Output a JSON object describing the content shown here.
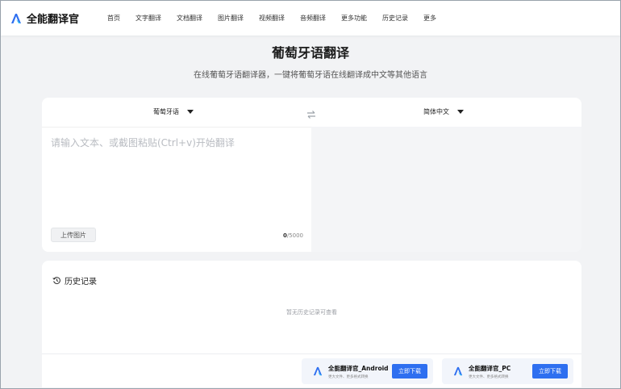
{
  "header": {
    "brand": "全能翻译官",
    "nav": [
      "首页",
      "文字翻译",
      "文档翻译",
      "图片翻译",
      "视频翻译",
      "音频翻译",
      "更多功能",
      "历史记录",
      "更多"
    ]
  },
  "hero": {
    "title": "葡萄牙语翻译",
    "subtitle": "在线葡萄牙语翻译器，一键将葡萄牙语在线翻译成中文等其他语言"
  },
  "translator": {
    "source_lang": "葡萄牙语",
    "target_lang": "简体中文",
    "input_placeholder": "请输入文本、或截图粘贴(Ctrl+v)开始翻译",
    "input_value": "",
    "upload_label": "上传图片",
    "char_count": "0",
    "char_limit": "/5000"
  },
  "history": {
    "title": "历史记录",
    "empty_text": "暂无历史记录可查看"
  },
  "downloads": [
    {
      "name": "全能翻译官_Android",
      "desc": "更大文件、更多格式转换",
      "button": "立即下载"
    },
    {
      "name": "全能翻译官_PC",
      "desc": "更大文件、更多格式转换",
      "button": "立即下载"
    }
  ],
  "colors": {
    "accent": "#2e6ff0",
    "page_bg": "#f2f3f5"
  },
  "icons": {
    "logo": "logo-a-icon",
    "swap": "swap-arrows-icon",
    "history": "history-clock-icon"
  }
}
